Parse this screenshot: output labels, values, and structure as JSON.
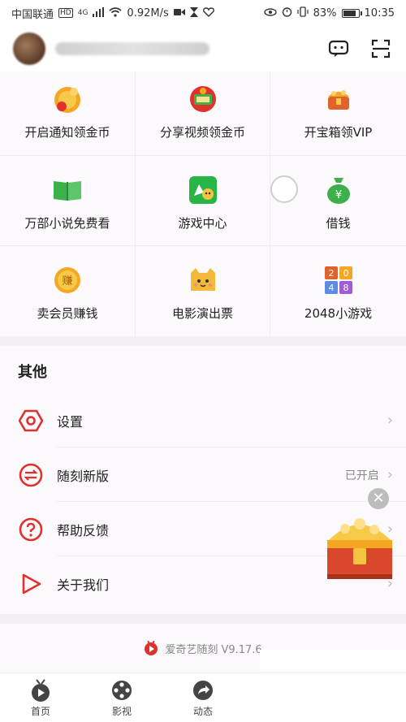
{
  "status_bar": {
    "carrier": "中国联通",
    "hd_badge": "HD",
    "network": "4G",
    "speed": "0.92M/s",
    "battery": "83%",
    "battery_level": 0.83,
    "time": "10:35"
  },
  "header": {
    "username": "",
    "message_icon": "message-icon",
    "scan_icon": "scan-icon"
  },
  "grid": {
    "items": [
      {
        "label": "开启通知领金币",
        "icon": "coin-bell-icon"
      },
      {
        "label": "分享视频领金币",
        "icon": "share-video-icon"
      },
      {
        "label": "开宝箱领VIP",
        "icon": "treasure-chest-icon"
      },
      {
        "label": "万部小说免费看",
        "icon": "book-icon"
      },
      {
        "label": "游戏中心",
        "icon": "gamepad-icon"
      },
      {
        "label": "借钱",
        "icon": "money-bag-icon"
      },
      {
        "label": "卖会员赚钱",
        "icon": "earn-coin-icon"
      },
      {
        "label": "电影演出票",
        "icon": "cat-ticket-icon"
      },
      {
        "label": "2048小游戏",
        "icon": "game-2048-icon"
      }
    ],
    "earn_badge": "赚",
    "money_badge": "¥",
    "tile_2048": [
      "2",
      "0",
      "4",
      "8"
    ]
  },
  "other": {
    "title": "其他",
    "rows": [
      {
        "label": "设置",
        "value": "",
        "icon": "settings-icon"
      },
      {
        "label": "随刻新版",
        "value": "已开启",
        "icon": "switch-icon"
      },
      {
        "label": "帮助反馈",
        "value": "",
        "icon": "help-icon"
      },
      {
        "label": "关于我们",
        "value": "",
        "icon": "play-icon"
      }
    ]
  },
  "footer": {
    "version_text": "爱奇艺随刻 V9.17.6"
  },
  "bottom_nav": {
    "items": [
      {
        "label": "首页",
        "icon": "home-tv-icon"
      },
      {
        "label": "影视",
        "icon": "film-reel-icon"
      },
      {
        "label": "动态",
        "icon": "share-arrow-icon"
      }
    ]
  },
  "floating": {
    "close": "✕",
    "icon": "treasure-chest-icon"
  },
  "colors": {
    "accent_red": "#e0322d",
    "gold": "#f5a623",
    "green": "#3cb04a"
  }
}
